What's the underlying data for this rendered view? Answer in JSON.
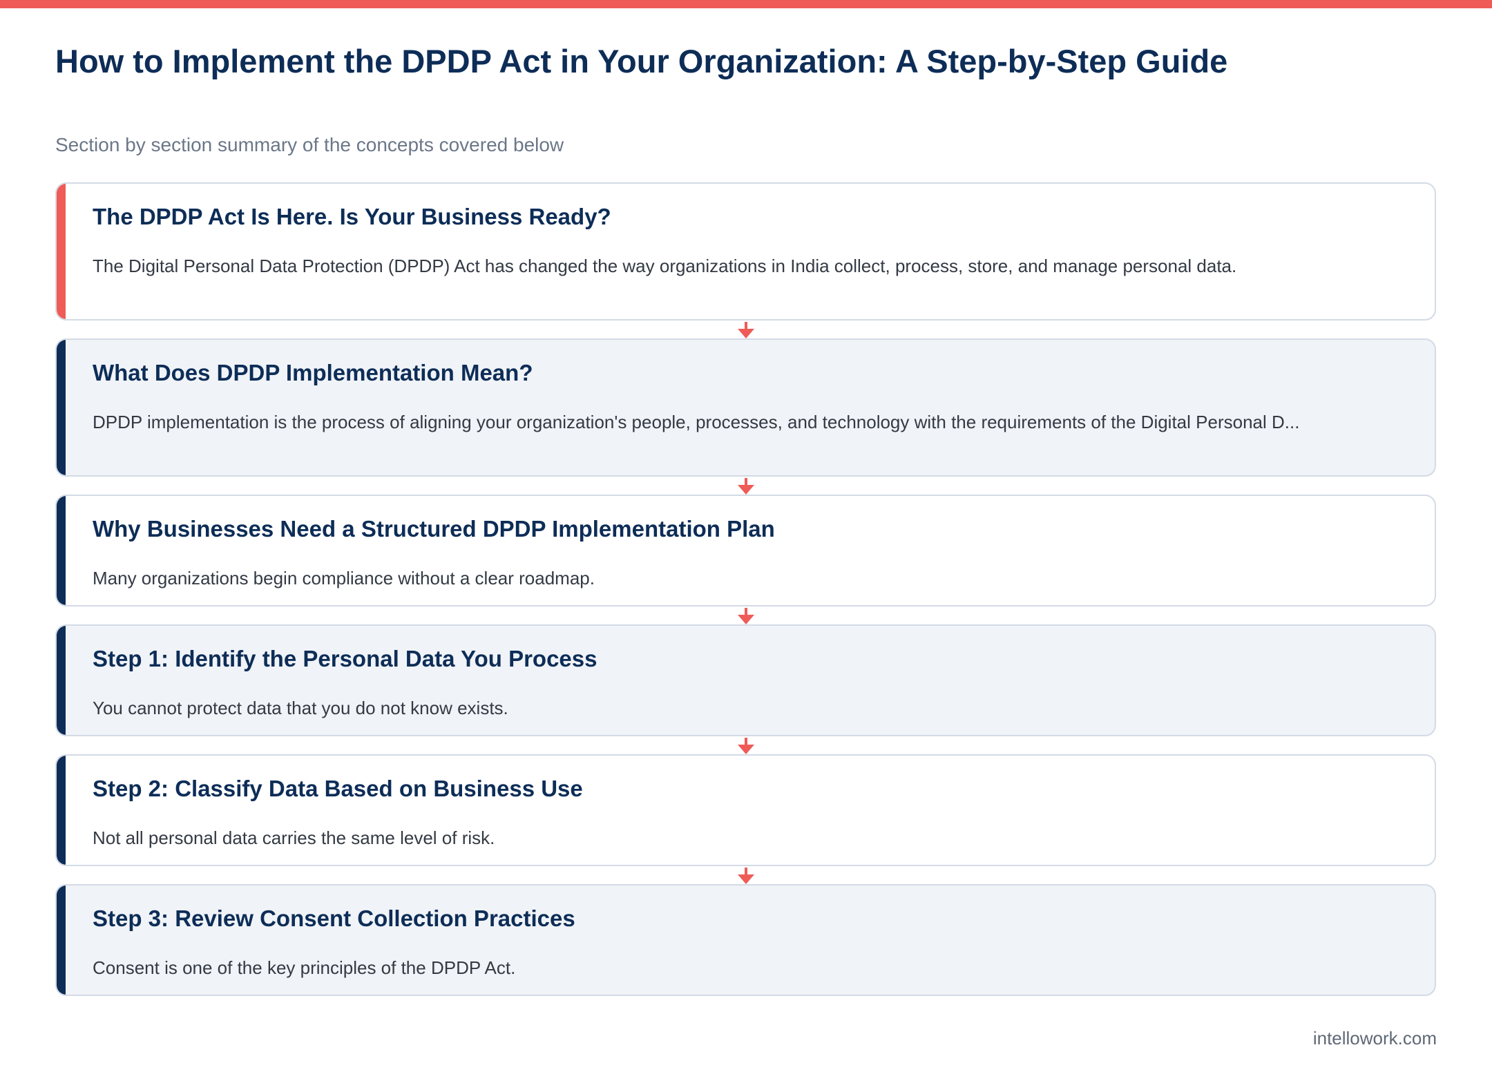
{
  "title": "How to Implement the DPDP Act in Your Organization: A Step-by-Step Guide",
  "subtitle": "Section by section summary of the concepts covered below",
  "accent_color": "#ef5b57",
  "heading_color": "#0d2d57",
  "steps": [
    {
      "heading": "The DPDP Act Is Here. Is Your Business Ready?",
      "text": "The Digital Personal Data Protection (DPDP) Act has changed the way organizations in India collect, process, store, and manage personal data."
    },
    {
      "heading": "What Does DPDP Implementation Mean?",
      "text": "DPDP implementation is the process of aligning your organization's people, processes, and technology with the requirements of the Digital Personal D..."
    },
    {
      "heading": "Why Businesses Need a Structured DPDP Implementation Plan",
      "text": "Many organizations begin compliance without a clear roadmap."
    },
    {
      "heading": "Step 1: Identify the Personal Data You Process",
      "text": "You cannot protect data that you do not know exists."
    },
    {
      "heading": "Step 2: Classify Data Based on Business Use",
      "text": "Not all personal data carries the same level of risk."
    },
    {
      "heading": "Step 3: Review Consent Collection Practices",
      "text": "Consent is one of the key principles of the DPDP Act."
    }
  ],
  "footer": "intellowork.com"
}
